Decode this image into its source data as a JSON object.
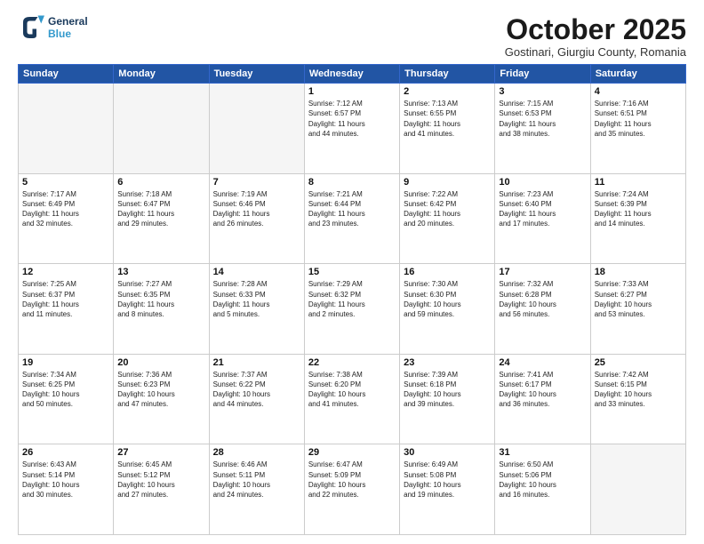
{
  "logo": {
    "line1": "General",
    "line2": "Blue"
  },
  "title": "October 2025",
  "subtitle": "Gostinari, Giurgiu County, Romania",
  "days": [
    "Sunday",
    "Monday",
    "Tuesday",
    "Wednesday",
    "Thursday",
    "Friday",
    "Saturday"
  ],
  "weeks": [
    [
      {
        "day": "",
        "content": ""
      },
      {
        "day": "",
        "content": ""
      },
      {
        "day": "",
        "content": ""
      },
      {
        "day": "1",
        "content": "Sunrise: 7:12 AM\nSunset: 6:57 PM\nDaylight: 11 hours\nand 44 minutes."
      },
      {
        "day": "2",
        "content": "Sunrise: 7:13 AM\nSunset: 6:55 PM\nDaylight: 11 hours\nand 41 minutes."
      },
      {
        "day": "3",
        "content": "Sunrise: 7:15 AM\nSunset: 6:53 PM\nDaylight: 11 hours\nand 38 minutes."
      },
      {
        "day": "4",
        "content": "Sunrise: 7:16 AM\nSunset: 6:51 PM\nDaylight: 11 hours\nand 35 minutes."
      }
    ],
    [
      {
        "day": "5",
        "content": "Sunrise: 7:17 AM\nSunset: 6:49 PM\nDaylight: 11 hours\nand 32 minutes."
      },
      {
        "day": "6",
        "content": "Sunrise: 7:18 AM\nSunset: 6:47 PM\nDaylight: 11 hours\nand 29 minutes."
      },
      {
        "day": "7",
        "content": "Sunrise: 7:19 AM\nSunset: 6:46 PM\nDaylight: 11 hours\nand 26 minutes."
      },
      {
        "day": "8",
        "content": "Sunrise: 7:21 AM\nSunset: 6:44 PM\nDaylight: 11 hours\nand 23 minutes."
      },
      {
        "day": "9",
        "content": "Sunrise: 7:22 AM\nSunset: 6:42 PM\nDaylight: 11 hours\nand 20 minutes."
      },
      {
        "day": "10",
        "content": "Sunrise: 7:23 AM\nSunset: 6:40 PM\nDaylight: 11 hours\nand 17 minutes."
      },
      {
        "day": "11",
        "content": "Sunrise: 7:24 AM\nSunset: 6:39 PM\nDaylight: 11 hours\nand 14 minutes."
      }
    ],
    [
      {
        "day": "12",
        "content": "Sunrise: 7:25 AM\nSunset: 6:37 PM\nDaylight: 11 hours\nand 11 minutes."
      },
      {
        "day": "13",
        "content": "Sunrise: 7:27 AM\nSunset: 6:35 PM\nDaylight: 11 hours\nand 8 minutes."
      },
      {
        "day": "14",
        "content": "Sunrise: 7:28 AM\nSunset: 6:33 PM\nDaylight: 11 hours\nand 5 minutes."
      },
      {
        "day": "15",
        "content": "Sunrise: 7:29 AM\nSunset: 6:32 PM\nDaylight: 11 hours\nand 2 minutes."
      },
      {
        "day": "16",
        "content": "Sunrise: 7:30 AM\nSunset: 6:30 PM\nDaylight: 10 hours\nand 59 minutes."
      },
      {
        "day": "17",
        "content": "Sunrise: 7:32 AM\nSunset: 6:28 PM\nDaylight: 10 hours\nand 56 minutes."
      },
      {
        "day": "18",
        "content": "Sunrise: 7:33 AM\nSunset: 6:27 PM\nDaylight: 10 hours\nand 53 minutes."
      }
    ],
    [
      {
        "day": "19",
        "content": "Sunrise: 7:34 AM\nSunset: 6:25 PM\nDaylight: 10 hours\nand 50 minutes."
      },
      {
        "day": "20",
        "content": "Sunrise: 7:36 AM\nSunset: 6:23 PM\nDaylight: 10 hours\nand 47 minutes."
      },
      {
        "day": "21",
        "content": "Sunrise: 7:37 AM\nSunset: 6:22 PM\nDaylight: 10 hours\nand 44 minutes."
      },
      {
        "day": "22",
        "content": "Sunrise: 7:38 AM\nSunset: 6:20 PM\nDaylight: 10 hours\nand 41 minutes."
      },
      {
        "day": "23",
        "content": "Sunrise: 7:39 AM\nSunset: 6:18 PM\nDaylight: 10 hours\nand 39 minutes."
      },
      {
        "day": "24",
        "content": "Sunrise: 7:41 AM\nSunset: 6:17 PM\nDaylight: 10 hours\nand 36 minutes."
      },
      {
        "day": "25",
        "content": "Sunrise: 7:42 AM\nSunset: 6:15 PM\nDaylight: 10 hours\nand 33 minutes."
      }
    ],
    [
      {
        "day": "26",
        "content": "Sunrise: 6:43 AM\nSunset: 5:14 PM\nDaylight: 10 hours\nand 30 minutes."
      },
      {
        "day": "27",
        "content": "Sunrise: 6:45 AM\nSunset: 5:12 PM\nDaylight: 10 hours\nand 27 minutes."
      },
      {
        "day": "28",
        "content": "Sunrise: 6:46 AM\nSunset: 5:11 PM\nDaylight: 10 hours\nand 24 minutes."
      },
      {
        "day": "29",
        "content": "Sunrise: 6:47 AM\nSunset: 5:09 PM\nDaylight: 10 hours\nand 22 minutes."
      },
      {
        "day": "30",
        "content": "Sunrise: 6:49 AM\nSunset: 5:08 PM\nDaylight: 10 hours\nand 19 minutes."
      },
      {
        "day": "31",
        "content": "Sunrise: 6:50 AM\nSunset: 5:06 PM\nDaylight: 10 hours\nand 16 minutes."
      },
      {
        "day": "",
        "content": ""
      }
    ]
  ]
}
